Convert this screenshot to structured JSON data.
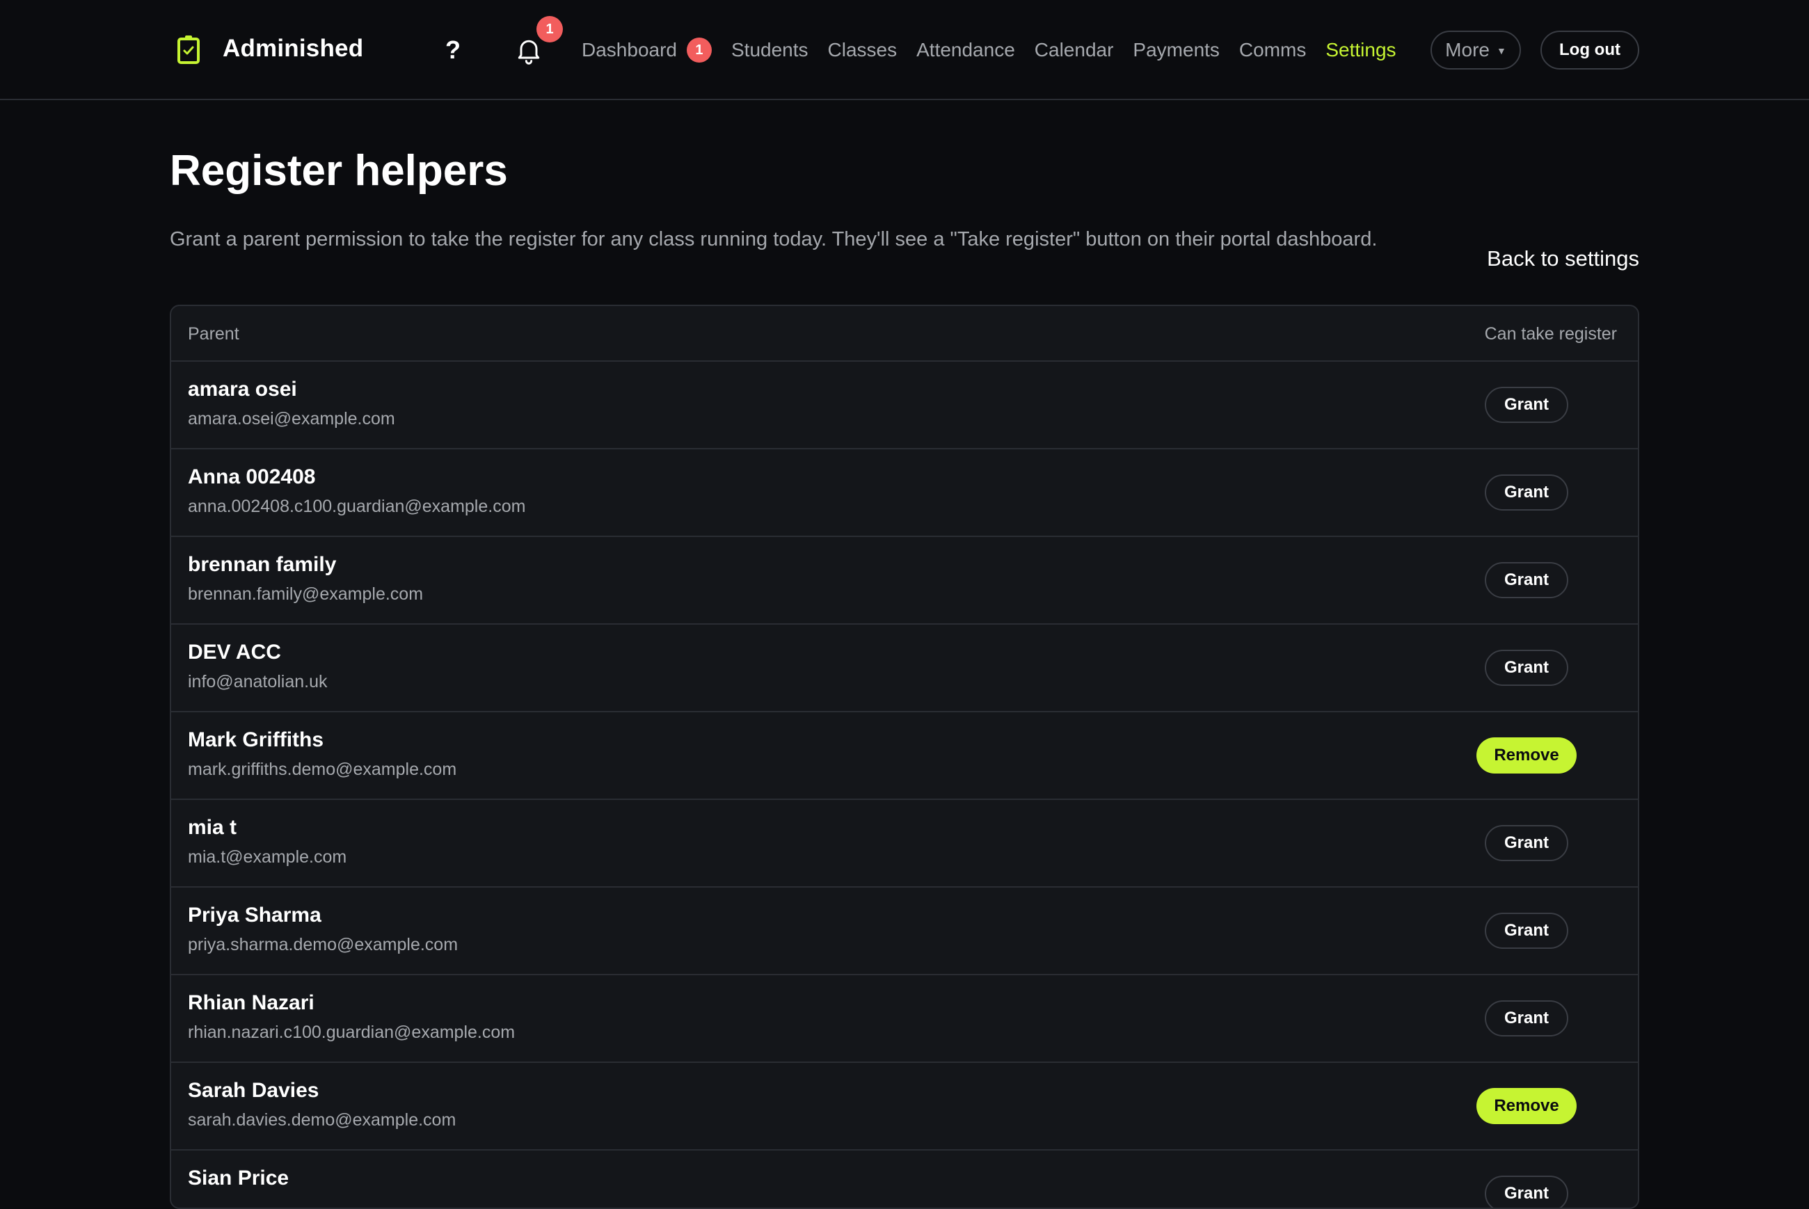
{
  "app": {
    "name": "Adminished"
  },
  "header": {
    "help_label": "?",
    "notifications_count": "1",
    "nav": [
      {
        "label": "Dashboard",
        "badge": "1",
        "active": false
      },
      {
        "label": "Students",
        "active": false
      },
      {
        "label": "Classes",
        "active": false
      },
      {
        "label": "Attendance",
        "active": false
      },
      {
        "label": "Calendar",
        "active": false
      },
      {
        "label": "Payments",
        "active": false
      },
      {
        "label": "Comms",
        "active": false
      },
      {
        "label": "Settings",
        "active": true
      }
    ],
    "more_label": "More",
    "logout_label": "Log out"
  },
  "page": {
    "title": "Register helpers",
    "description": "Grant a parent permission to take the register for any class running today. They'll see a \"Take register\" button on their portal dashboard.",
    "back_link": "Back to settings"
  },
  "table": {
    "columns": {
      "parent": "Parent",
      "register": "Can take register"
    },
    "rows": [
      {
        "name": "amara osei",
        "email": "amara.osei@example.com",
        "action": "Grant",
        "granted": false
      },
      {
        "name": "Anna 002408",
        "email": "anna.002408.c100.guardian@example.com",
        "action": "Grant",
        "granted": false
      },
      {
        "name": "brennan family",
        "email": "brennan.family@example.com",
        "action": "Grant",
        "granted": false
      },
      {
        "name": "DEV ACC",
        "email": "info@anatolian.uk",
        "action": "Grant",
        "granted": false
      },
      {
        "name": "Mark Griffiths",
        "email": "mark.griffiths.demo@example.com",
        "action": "Remove",
        "granted": true
      },
      {
        "name": "mia t",
        "email": "mia.t@example.com",
        "action": "Grant",
        "granted": false
      },
      {
        "name": "Priya Sharma",
        "email": "priya.sharma.demo@example.com",
        "action": "Grant",
        "granted": false
      },
      {
        "name": "Rhian Nazari",
        "email": "rhian.nazari.c100.guardian@example.com",
        "action": "Grant",
        "granted": false
      },
      {
        "name": "Sarah Davies",
        "email": "sarah.davies.demo@example.com",
        "action": "Remove",
        "granted": true
      },
      {
        "name": "Sian Price",
        "email": "",
        "action": "Grant",
        "granted": false
      }
    ]
  },
  "colors": {
    "accent": "#c6f432",
    "background": "#0b0c0f",
    "surface": "#14161a",
    "badge": "#f25d5d",
    "muted_text": "#a6a9ae"
  },
  "icons": {
    "brand": "clipboard-check-icon",
    "help": "question-icon",
    "notifications": "bell-icon",
    "more": "caret-down-icon"
  }
}
